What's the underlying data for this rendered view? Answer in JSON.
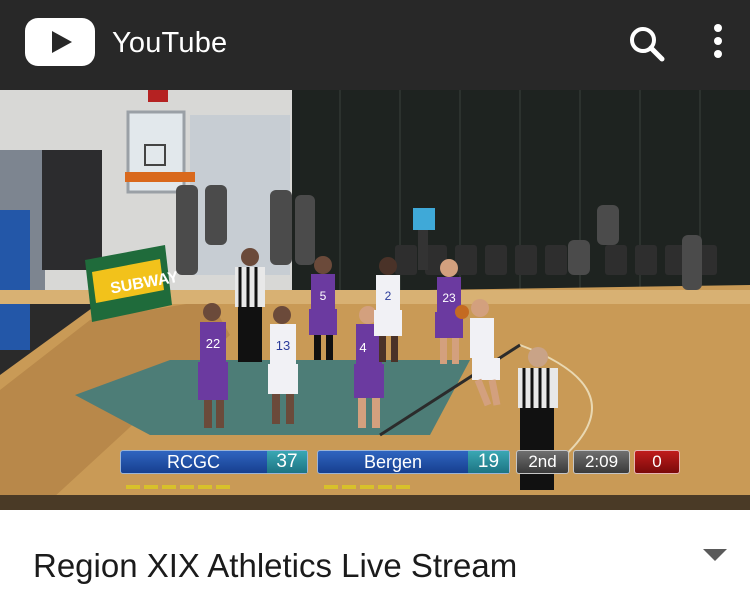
{
  "app": {
    "name": "YouTube",
    "logo_icon": "youtube-play-icon"
  },
  "toolbar": {
    "search_icon": "search-icon",
    "more_icon": "more-vert-icon"
  },
  "video": {
    "description": "basketball game free throw",
    "scoreboard": {
      "home_team": "RCGC",
      "home_score": "37",
      "away_team": "Bergen",
      "away_score": "19",
      "period": "2nd",
      "clock": "2:09",
      "shot_indicator": "0"
    },
    "sponsor_sign": "SUBWAY",
    "jerseys": [
      "22",
      "13",
      "4",
      "5",
      "2",
      "23"
    ]
  },
  "title": {
    "text": "Region XIX Athletics Live Stream",
    "expand_icon": "chevron-down-icon"
  },
  "colors": {
    "appbar": "#282828",
    "scoreboard_blue": "#1e4fa8",
    "scoreboard_teal": "#2a8f9c",
    "shot_red": "#a01212"
  }
}
